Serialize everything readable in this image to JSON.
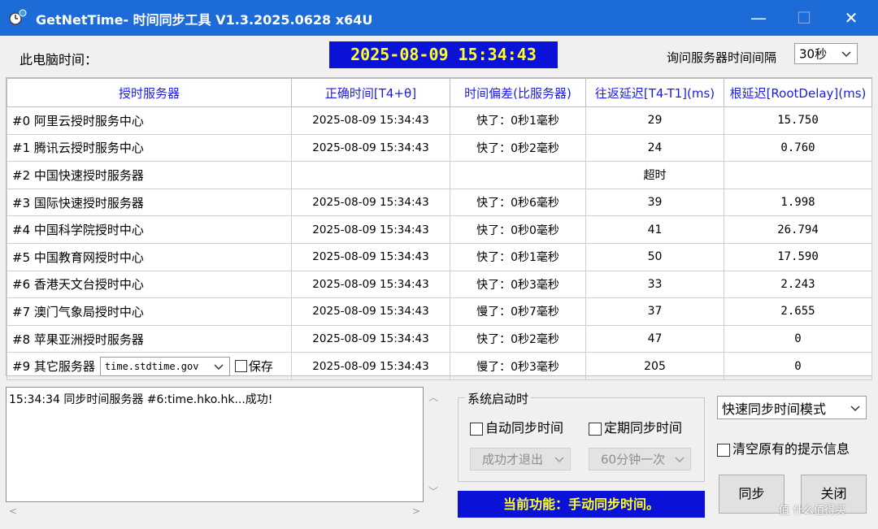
{
  "window": {
    "title": "GetNetTime- 时间同步工具 V1.3.2025.0628 x64U",
    "min_glyph": "—",
    "max_glyph": "☐",
    "close_glyph": "✕"
  },
  "header": {
    "pc_time_label": "此电脑时间：",
    "clock": "2025-08-09  15:34:43",
    "interval_label": "询问服务器时间间隔",
    "interval_value": "30秒"
  },
  "table": {
    "columns": [
      "授时服务器",
      "正确时间[T4+θ]",
      "时间偏差(比服务器)",
      "往返延迟[T4-T1](ms)",
      "根延迟[RootDelay](ms)"
    ],
    "rows": [
      {
        "name": "#0 阿里云授时服务中心",
        "time": "2025-08-09   15:34:43",
        "diff": "快了：0秒1毫秒",
        "rtt": "29",
        "root": "15.750"
      },
      {
        "name": "#1 腾讯云授时服务中心",
        "time": "2025-08-09   15:34:43",
        "diff": "快了：0秒2毫秒",
        "rtt": "24",
        "root": "0.760"
      },
      {
        "name": "#2 中国快速授时服务器",
        "time": "",
        "diff": "",
        "rtt": "超时",
        "root": ""
      },
      {
        "name": "#3 国际快速授时服务器",
        "time": "2025-08-09   15:34:43",
        "diff": "快了：0秒6毫秒",
        "rtt": "39",
        "root": "1.998"
      },
      {
        "name": "#4 中国科学院授时中心",
        "time": "2025-08-09   15:34:43",
        "diff": "快了：0秒0毫秒",
        "rtt": "41",
        "root": "26.794"
      },
      {
        "name": "#5 中国教育网授时中心",
        "time": "2025-08-09   15:34:43",
        "diff": "快了：0秒1毫秒",
        "rtt": "50",
        "root": "17.590"
      },
      {
        "name": "#6 香港天文台授时中心",
        "time": "2025-08-09   15:34:43",
        "diff": "快了：0秒3毫秒",
        "rtt": "33",
        "root": "2.243"
      },
      {
        "name": "#7 澳门气象局授时中心",
        "time": "2025-08-09   15:34:43",
        "diff": "慢了：0秒7毫秒",
        "rtt": "37",
        "root": "2.655"
      },
      {
        "name": "#8 苹果亚洲授时服务器",
        "time": "2025-08-09   15:34:43",
        "diff": "快了：0秒2毫秒",
        "rtt": "47",
        "root": "0"
      }
    ],
    "other_row": {
      "label": "#9 其它服务器",
      "select_value": "time.stdtime.gov",
      "save_label": "保存",
      "time": "2025-08-09   15:34:43",
      "diff": "慢了：0秒3毫秒",
      "rtt": "205",
      "root": "0"
    }
  },
  "log": {
    "text": "15:34:34 同步时间服务器 #6:time.hko.hk...成功!"
  },
  "startup": {
    "group_title": "系统启动时",
    "auto_sync_label": "自动同步时间",
    "periodic_sync_label": "定期同步时间",
    "exit_option": "成功才退出",
    "freq_option": "60分钟一次"
  },
  "function_bar": "当前功能：手动同步时间。",
  "mode_select": "快速同步时间模式",
  "clear_label": "清空原有的提示信息",
  "buttons": {
    "sync": "同步",
    "close": "关闭"
  },
  "watermark": "值 什么值得买",
  "colors": {
    "titlebar": "#1c6bd6",
    "clock_bg": "#0a12d8",
    "clock_fg": "#ffff22",
    "header_text": "#1b1be8"
  }
}
